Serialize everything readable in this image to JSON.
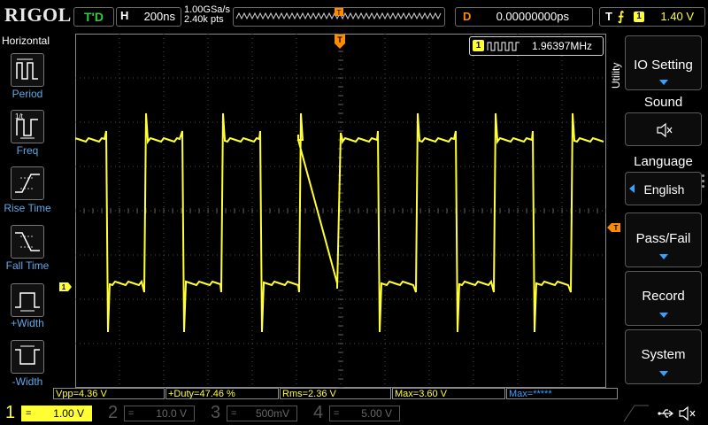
{
  "brand": "RIGOL",
  "status": "T'D",
  "horizontal": {
    "label": "H",
    "timebase": "200ns",
    "sample_rate": "1.00GSa/s",
    "mem_depth": "2.40k pts",
    "mem_marker": "T"
  },
  "delay": {
    "label": "D",
    "value": "0.00000000ps"
  },
  "trigger": {
    "label": "T",
    "edge_icon": "rising-edge",
    "channel": "1",
    "level": "1.40 V",
    "marker": "T"
  },
  "left_panel": {
    "title": "Horizontal",
    "items": [
      {
        "label": "Period",
        "icon": "period-icon"
      },
      {
        "label": "Freq",
        "icon": "freq-icon"
      },
      {
        "label": "Rise Time",
        "icon": "rise-time-icon"
      },
      {
        "label": "Fall Time",
        "icon": "fall-time-icon"
      },
      {
        "label": "+Width",
        "icon": "pos-width-icon"
      },
      {
        "label": "-Width",
        "icon": "neg-width-icon"
      }
    ]
  },
  "freq_counter": {
    "channel": "1",
    "value": "1.96397MHz"
  },
  "channel1_marker": "1",
  "utility_label": "Utility",
  "right_menu": {
    "io_setting": "IO Setting",
    "sound": {
      "title": "Sound",
      "icon": "speaker-mute-icon"
    },
    "language": {
      "title": "Language",
      "value": "English"
    },
    "pass_fail": "Pass/Fail",
    "record": "Record",
    "system": "System"
  },
  "measurements": [
    "Vpp=4.36 V",
    "+Duty=47.46 %",
    "Rms=2.36 V",
    "Max=3.60 V",
    "Max=*****"
  ],
  "channels": [
    {
      "num": "1",
      "scale": "1.00 V",
      "coupling": "=",
      "color": "#ffff33",
      "active": true
    },
    {
      "num": "2",
      "scale": "10.0 V",
      "coupling": "=",
      "color": "#00c0e0",
      "active": false
    },
    {
      "num": "3",
      "scale": "500mV",
      "coupling": "=",
      "color": "#c040c0",
      "active": false
    },
    {
      "num": "4",
      "scale": "5.00 V",
      "coupling": "=",
      "color": "#2060ff",
      "active": false
    }
  ],
  "colors": {
    "ch1": "#ffff33",
    "trigger": "#ff8c00",
    "accent": "#3aa0ff"
  },
  "icons": {
    "usb": "usb-icon",
    "mute": "speaker-mute-icon"
  }
}
